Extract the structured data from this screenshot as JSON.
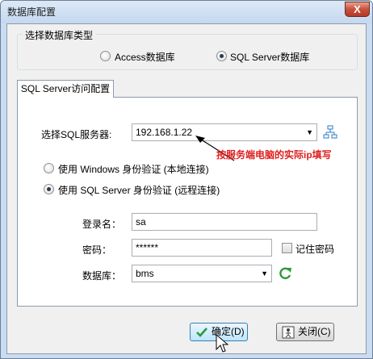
{
  "window": {
    "title": "数据库配置",
    "close_label": "X"
  },
  "db_type_group": {
    "title": "选择数据库类型",
    "options": [
      {
        "label": "Access数据库",
        "checked": false
      },
      {
        "label": "SQL Server数据库",
        "checked": true
      }
    ]
  },
  "tab": {
    "label": "SQL Server访问配置"
  },
  "server": {
    "label": "选择SQL服务器:",
    "value": "192.168.1.22"
  },
  "annotation": "按服务端电脑的实际ip填写",
  "auth": {
    "windows_label": "使用 Windows 身份验证  (本地连接)",
    "sql_label": "使用 SQL Server 身份验证 (远程连接)",
    "selected": "sql"
  },
  "login": {
    "label": "登录名：",
    "value": "sa"
  },
  "password": {
    "label": "密码：",
    "value": "******",
    "remember_label": "记住密码"
  },
  "database": {
    "label": "数据库：",
    "value": "bms"
  },
  "buttons": {
    "ok_label": "确定(D)",
    "close_label": "关闭(C)"
  },
  "colors": {
    "annotation": "#e02020",
    "refresh_icon": "#2e9a3e"
  }
}
